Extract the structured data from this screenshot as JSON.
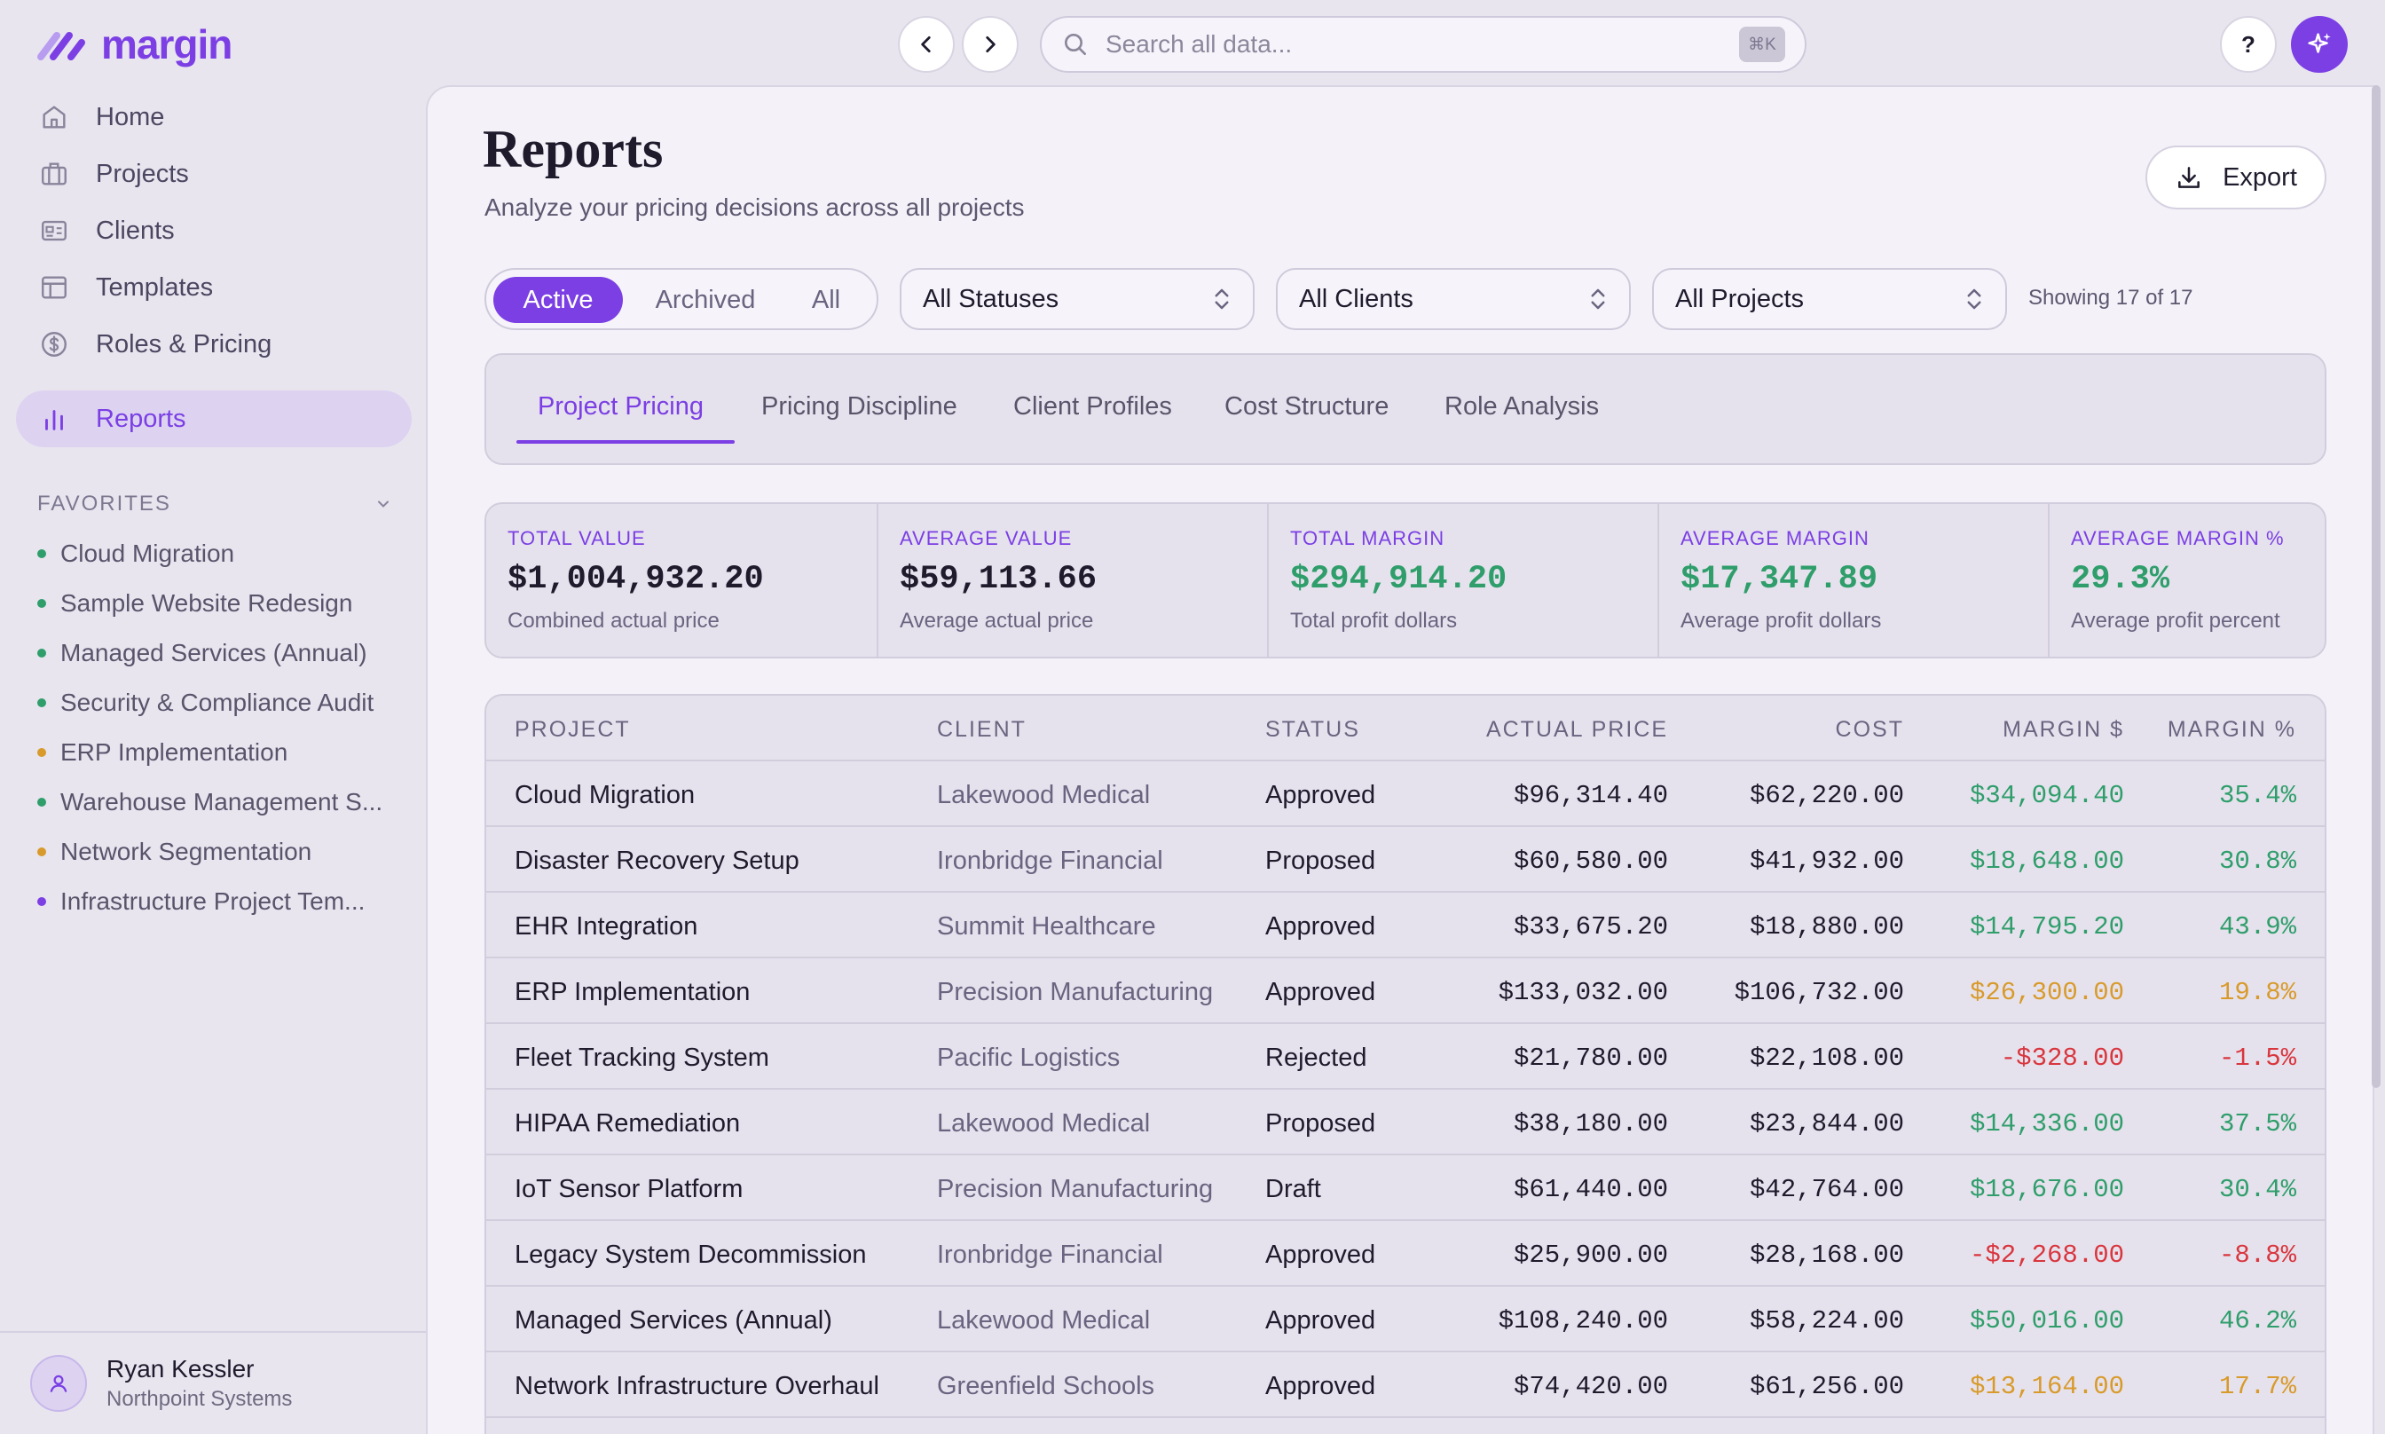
{
  "app": {
    "brand": "margin"
  },
  "search": {
    "placeholder": "Search all data...",
    "shortcut": "⌘K"
  },
  "help_label": "?",
  "sidebar": {
    "items": [
      {
        "label": "Home",
        "icon": "home-icon"
      },
      {
        "label": "Projects",
        "icon": "briefcase-icon"
      },
      {
        "label": "Clients",
        "icon": "id-card-icon"
      },
      {
        "label": "Templates",
        "icon": "template-icon"
      },
      {
        "label": "Roles & Pricing",
        "icon": "dollar-icon"
      },
      {
        "label": "Reports",
        "icon": "bar-chart-icon",
        "active": true
      }
    ],
    "favorites_label": "FAVORITES",
    "favorites": [
      {
        "label": "Cloud Migration",
        "color": "#2f9e6b"
      },
      {
        "label": "Sample Website Redesign",
        "color": "#2f9e6b"
      },
      {
        "label": "Managed Services (Annual)",
        "color": "#2f9e6b"
      },
      {
        "label": "Security & Compliance Audit",
        "color": "#2f9e6b"
      },
      {
        "label": "ERP Implementation",
        "color": "#d89a2b"
      },
      {
        "label": "Warehouse Management S...",
        "color": "#2f9e6b"
      },
      {
        "label": "Network Segmentation",
        "color": "#d89a2b"
      },
      {
        "label": "Infrastructure Project Tem...",
        "color": "#7b3fe4"
      }
    ],
    "user": {
      "name": "Ryan Kessler",
      "org": "Northpoint Systems"
    }
  },
  "page": {
    "title": "Reports",
    "subtitle": "Analyze your pricing decisions across all projects",
    "export_label": "Export"
  },
  "filters": {
    "segments": [
      "Active",
      "Archived",
      "All"
    ],
    "active_segment": "Active",
    "status": "All Statuses",
    "client": "All Clients",
    "project": "All Projects",
    "showing": "Showing 17 of 17"
  },
  "tabs": [
    "Project Pricing",
    "Pricing Discipline",
    "Client Profiles",
    "Cost Structure",
    "Role Analysis"
  ],
  "active_tab": "Project Pricing",
  "stats": [
    {
      "label": "TOTAL VALUE",
      "value": "$1,004,932.20",
      "sub": "Combined actual price",
      "color": "#1f1b2d"
    },
    {
      "label": "AVERAGE VALUE",
      "value": "$59,113.66",
      "sub": "Average actual price",
      "color": "#1f1b2d"
    },
    {
      "label": "TOTAL MARGIN",
      "value": "$294,914.20",
      "sub": "Total profit dollars",
      "color": "#2f9e6b"
    },
    {
      "label": "AVERAGE MARGIN",
      "value": "$17,347.89",
      "sub": "Average profit dollars",
      "color": "#2f9e6b"
    },
    {
      "label": "AVERAGE MARGIN %",
      "value": "29.3%",
      "sub": "Average profit percent",
      "color": "#2f9e6b"
    }
  ],
  "table": {
    "headers": [
      "PROJECT",
      "CLIENT",
      "STATUS",
      "ACTUAL PRICE",
      "COST",
      "MARGIN $",
      "MARGIN %"
    ],
    "rows": [
      {
        "project": "Cloud Migration",
        "client": "Lakewood Medical",
        "status": "Approved",
        "price": "$96,314.40",
        "cost": "$62,220.00",
        "margin": "$34,094.40",
        "pct": "35.4%",
        "tone": "good"
      },
      {
        "project": "Disaster Recovery Setup",
        "client": "Ironbridge Financial",
        "status": "Proposed",
        "price": "$60,580.00",
        "cost": "$41,932.00",
        "margin": "$18,648.00",
        "pct": "30.8%",
        "tone": "good"
      },
      {
        "project": "EHR Integration",
        "client": "Summit Healthcare",
        "status": "Approved",
        "price": "$33,675.20",
        "cost": "$18,880.00",
        "margin": "$14,795.20",
        "pct": "43.9%",
        "tone": "good"
      },
      {
        "project": "ERP Implementation",
        "client": "Precision Manufacturing",
        "status": "Approved",
        "price": "$133,032.00",
        "cost": "$106,732.00",
        "margin": "$26,300.00",
        "pct": "19.8%",
        "tone": "warn"
      },
      {
        "project": "Fleet Tracking System",
        "client": "Pacific Logistics",
        "status": "Rejected",
        "price": "$21,780.00",
        "cost": "$22,108.00",
        "margin": "-$328.00",
        "pct": "-1.5%",
        "tone": "bad"
      },
      {
        "project": "HIPAA Remediation",
        "client": "Lakewood Medical",
        "status": "Proposed",
        "price": "$38,180.00",
        "cost": "$23,844.00",
        "margin": "$14,336.00",
        "pct": "37.5%",
        "tone": "good"
      },
      {
        "project": "IoT Sensor Platform",
        "client": "Precision Manufacturing",
        "status": "Draft",
        "price": "$61,440.00",
        "cost": "$42,764.00",
        "margin": "$18,676.00",
        "pct": "30.4%",
        "tone": "good"
      },
      {
        "project": "Legacy System Decommission",
        "client": "Ironbridge Financial",
        "status": "Approved",
        "price": "$25,900.00",
        "cost": "$28,168.00",
        "margin": "-$2,268.00",
        "pct": "-8.8%",
        "tone": "bad"
      },
      {
        "project": "Managed Services (Annual)",
        "client": "Lakewood Medical",
        "status": "Approved",
        "price": "$108,240.00",
        "cost": "$58,224.00",
        "margin": "$50,016.00",
        "pct": "46.2%",
        "tone": "good"
      },
      {
        "project": "Network Infrastructure Overhaul",
        "client": "Greenfield Schools",
        "status": "Approved",
        "price": "$74,420.00",
        "cost": "$61,256.00",
        "margin": "$13,164.00",
        "pct": "17.7%",
        "tone": "warn"
      }
    ]
  },
  "colors": {
    "accent": "#7b3fe4",
    "good": "#2f9e6b",
    "warn": "#d89a2b",
    "bad": "#d9363e"
  }
}
